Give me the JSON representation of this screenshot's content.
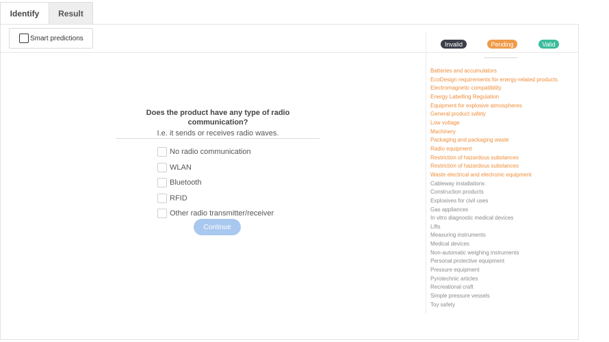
{
  "tabs": [
    {
      "label": "Identify",
      "active": true
    },
    {
      "label": "Result",
      "active": false
    }
  ],
  "toolbar": {
    "smart_predictions_label": "Smart predictions",
    "smart_predictions_checked": false
  },
  "question": {
    "title": "Does the product have any type of radio communication?",
    "subtitle": "I.e. it sends or receives radio waves.",
    "options": [
      "No radio communication",
      "WLAN",
      "Bluetooth",
      "RFID",
      "Other radio transmitter/receiver"
    ],
    "continue_label": "Continue"
  },
  "legend": {
    "invalid": {
      "label": "Invalid",
      "color": "#3c3f4a"
    },
    "pending": {
      "label": "Pending",
      "color": "#f09a48"
    },
    "valid": {
      "label": "Valid",
      "color": "#3cbc9c"
    }
  },
  "directives": [
    {
      "label": "Batteries and accumulators",
      "status": "pending"
    },
    {
      "label": "EcoDesign requirements for energy-related products",
      "status": "pending"
    },
    {
      "label": "Electromagnetic compatibility",
      "status": "pending"
    },
    {
      "label": "Energy Labelling Regulation",
      "status": "pending"
    },
    {
      "label": "Equipment for explosive atmospheres",
      "status": "pending"
    },
    {
      "label": "General product safety",
      "status": "pending"
    },
    {
      "label": "Low voltage",
      "status": "pending"
    },
    {
      "label": "Machinery",
      "status": "pending"
    },
    {
      "label": "Packaging and packaging waste",
      "status": "pending"
    },
    {
      "label": "Radio equipment",
      "status": "pending"
    },
    {
      "label": "Restriction of hazardous substances",
      "status": "pending"
    },
    {
      "label": "Restriction of hazardous substances",
      "status": "pending"
    },
    {
      "label": "Waste electrical and electronic equipment",
      "status": "pending"
    },
    {
      "label": "Cableway installations",
      "status": "neutral"
    },
    {
      "label": "Construction products",
      "status": "neutral"
    },
    {
      "label": "Explosives for civil uses",
      "status": "neutral"
    },
    {
      "label": "Gas appliances",
      "status": "neutral"
    },
    {
      "label": "In vitro diagnostic medical devices",
      "status": "neutral"
    },
    {
      "label": "Lifts",
      "status": "neutral"
    },
    {
      "label": "Measuring instruments",
      "status": "neutral"
    },
    {
      "label": "Medical devices",
      "status": "neutral"
    },
    {
      "label": "Non-automatic weighing instruments",
      "status": "neutral"
    },
    {
      "label": "Personal protective equipment",
      "status": "neutral"
    },
    {
      "label": "Pressure equipment",
      "status": "neutral"
    },
    {
      "label": "Pyrotechnic articles",
      "status": "neutral"
    },
    {
      "label": "Recreational craft",
      "status": "neutral"
    },
    {
      "label": "Simple pressure vessels",
      "status": "neutral"
    },
    {
      "label": "Toy safety",
      "status": "neutral"
    }
  ]
}
